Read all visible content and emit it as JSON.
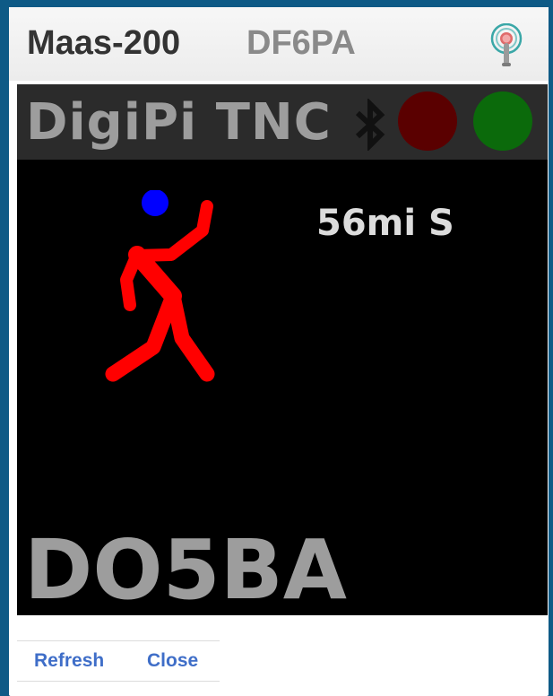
{
  "header": {
    "name": "Maas-200",
    "callsign": "DF6PA",
    "icon": "podcast-icon"
  },
  "display": {
    "title": "DigiPi TNC",
    "bluetooth_icon": "bluetooth-icon",
    "led_colors": {
      "red": "#5a0000",
      "green": "#0b6a0b"
    },
    "symbol": "runner-icon",
    "distance": "56mi S",
    "station": "DO5BA"
  },
  "footer": {
    "refresh_label": "Refresh",
    "close_label": "Close"
  },
  "colors": {
    "background": "#0e5a86",
    "link": "#3f6ec8",
    "runner": "#ff0000",
    "runner_head": "#0000ff"
  }
}
